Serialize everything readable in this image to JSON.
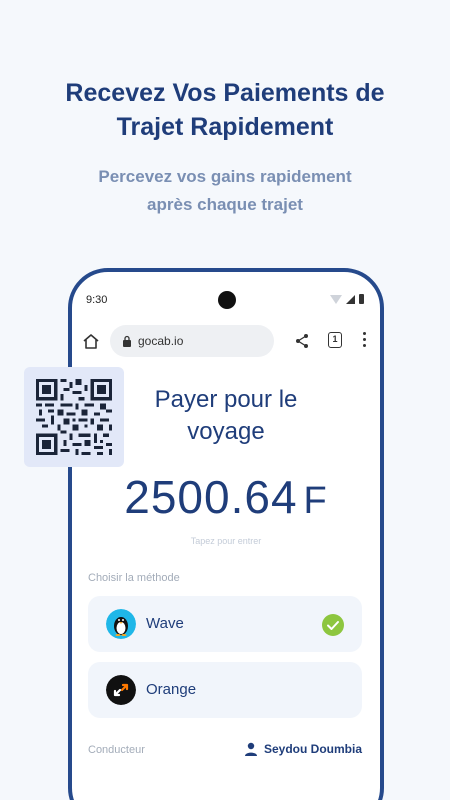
{
  "header": {
    "headline_line1": "Recevez Vos Paiements de",
    "headline_line2": "Trajet Rapidement",
    "sub_line1": "Percevez vos gains rapidement",
    "sub_line2": "après chaque trajet"
  },
  "phone": {
    "status": {
      "time": "9:30"
    },
    "browser": {
      "url": "gocab.io",
      "tab_count": "1"
    },
    "payment": {
      "title_line1": "Payer pour le",
      "title_line2": "voyage",
      "amount": "2500.64",
      "currency": "F",
      "hint": "Tapez pour entrer"
    },
    "methods": {
      "label": "Choisir la méthode",
      "items": [
        {
          "name": "Wave",
          "selected": true
        },
        {
          "name": "Orange",
          "selected": false
        }
      ]
    },
    "driver": {
      "label": "Conducteur",
      "name": "Seydou Doumbia"
    }
  },
  "colors": {
    "primary": "#1f3d7a",
    "frame": "#264a8c",
    "background": "#f5f8fc",
    "card": "#f1f5fb",
    "wave_bg": "#1fb7e8",
    "check": "#8dc63f"
  }
}
